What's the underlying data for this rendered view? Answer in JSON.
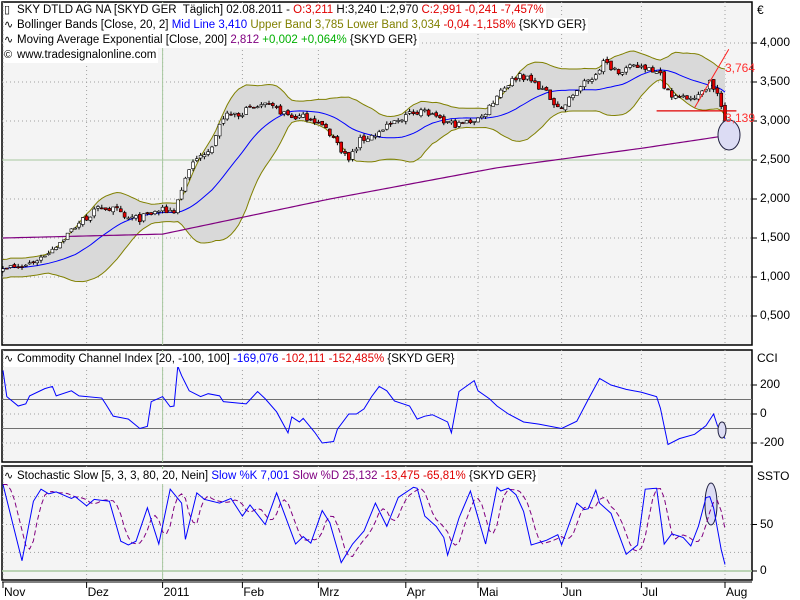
{
  "header": {
    "symbol": "SKY DTLD AG NA [SKYD GER  Täglich] 02.08.2011 -",
    "open": " O:3,211",
    "high_low": " H:3,240 L:2,970",
    "close_change": " C:2,991 -0,241 -7,457%"
  },
  "bollinger": {
    "name": "Bollinger Bands [Close, 20, 2]",
    "mid": " Mid Line 3,410",
    "bands": " Upper Band 3,785 Lower Band 3,034",
    "change": " -0,04 -1,158%",
    "symbol": " {SKYD GER}"
  },
  "ema": {
    "name": "Moving Average Exponential [Close, 200]",
    "value": " 2,812",
    "change": " +0,002 +0,064%",
    "symbol": " {SKYD GER}"
  },
  "copyright": "www.tradesignalonline.com",
  "cci_legend": {
    "name": "Commodity Channel Index [20, -100, 100]",
    "value": " -169,076",
    "change": " -102,111 -152,485%",
    "symbol": " {SKYD GER}"
  },
  "stoch_legend": {
    "name": "Stochastic Slow [5, 3, 3, 80, 20, Nein]",
    "k": " Slow %K 7,001",
    "d": " Slow %D 25,132",
    "change": " -13,475 -65,81%",
    "symbol": " {SKYD GER}"
  },
  "axes": {
    "price_unit": "€",
    "price_ticks": [
      "4,000",
      "3,500",
      "3,000",
      "2,500",
      "2,000",
      "1,500",
      "1,000",
      "0,500"
    ],
    "cci_label": "CCI",
    "cci_ticks": [
      "200",
      "0",
      "-200"
    ],
    "stoch_label": "SSTO",
    "stoch_ticks": [
      "50",
      "0"
    ],
    "months": [
      "Nov",
      "Dez",
      "2011",
      "Feb",
      "Mrz",
      "Apr",
      "Mai",
      "Jun",
      "Jul",
      "Aug"
    ]
  },
  "annotations": {
    "resistance_label": "3,764",
    "support_label": "3,139"
  },
  "colors": {
    "up": "#ffffff",
    "down": "#e00000",
    "mid": "#0000ff",
    "band": "#808000",
    "bandfill": "#d9d9d9",
    "ema": "#800080",
    "cci": "#0000ff",
    "k": "#0000ff",
    "d": "#800080",
    "grid": "#a0a0a0",
    "cross": "#a8c8a0"
  },
  "chart_data": [
    {
      "type": "candlestick",
      "title": "SKY DTLD AG NA [SKYD GER Täglich]",
      "xlabel": "",
      "ylabel": "€",
      "xlim": [
        0,
        197
      ],
      "ylim": [
        0.3,
        4.3
      ],
      "month_ticks": [
        0,
        22,
        42,
        63,
        83,
        106,
        125,
        147,
        168,
        190
      ],
      "close_keypoints": [
        [
          0,
          1.15
        ],
        [
          4,
          1.1
        ],
        [
          10,
          1.25
        ],
        [
          15,
          1.45
        ],
        [
          20,
          1.7
        ],
        [
          26,
          1.9
        ],
        [
          30,
          1.85
        ],
        [
          32,
          1.75
        ],
        [
          36,
          1.75
        ],
        [
          41,
          1.85
        ],
        [
          45,
          1.85
        ],
        [
          49,
          2.4
        ],
        [
          55,
          2.7
        ],
        [
          58,
          3.05
        ],
        [
          62,
          3.1
        ],
        [
          68,
          3.2
        ],
        [
          72,
          3.15
        ],
        [
          76,
          3.05
        ],
        [
          81,
          3.05
        ],
        [
          86,
          2.85
        ],
        [
          91,
          2.5
        ],
        [
          94,
          2.75
        ],
        [
          99,
          2.85
        ],
        [
          105,
          3.05
        ],
        [
          110,
          3.15
        ],
        [
          115,
          3.0
        ],
        [
          120,
          2.95
        ],
        [
          126,
          3.05
        ],
        [
          131,
          3.4
        ],
        [
          136,
          3.6
        ],
        [
          141,
          3.45
        ],
        [
          147,
          3.15
        ],
        [
          151,
          3.4
        ],
        [
          155,
          3.55
        ],
        [
          158,
          3.75
        ],
        [
          162,
          3.65
        ],
        [
          168,
          3.7
        ],
        [
          173,
          3.65
        ],
        [
          174,
          3.4
        ],
        [
          178,
          3.3
        ],
        [
          183,
          3.3
        ],
        [
          186,
          3.5
        ],
        [
          188,
          3.35
        ],
        [
          190,
          2.99
        ]
      ],
      "ema200_keypoints": [
        [
          0,
          1.5
        ],
        [
          42,
          1.55
        ],
        [
          86,
          2.0
        ],
        [
          130,
          2.4
        ],
        [
          168,
          2.65
        ],
        [
          190,
          2.81
        ]
      ],
      "crosshair": {
        "day": 42,
        "price": 2.5
      },
      "support_line": {
        "from_day": 172,
        "to_day": 193,
        "price": 3.13
      },
      "trend_line": {
        "from": [
          182,
          3.17
        ],
        "to": [
          191,
          3.92
        ]
      }
    },
    {
      "type": "line",
      "title": "Commodity Channel Index",
      "ylim": [
        -300,
        350
      ],
      "levels": [
        100,
        -100
      ],
      "series": [
        {
          "name": "CCI",
          "points": [
            [
              0,
              300
            ],
            [
              1,
              120
            ],
            [
              4,
              55
            ],
            [
              6,
              70
            ],
            [
              7,
              125
            ],
            [
              11,
              175
            ],
            [
              13,
              190
            ],
            [
              14,
              125
            ],
            [
              18,
              160
            ],
            [
              20,
              125
            ],
            [
              26,
              110
            ],
            [
              27,
              70
            ],
            [
              29,
              -15
            ],
            [
              33,
              -35
            ],
            [
              36,
              -100
            ],
            [
              38,
              -85
            ],
            [
              39,
              85
            ],
            [
              42,
              120
            ],
            [
              44,
              50
            ],
            [
              45,
              55
            ],
            [
              46,
              330
            ],
            [
              47,
              265
            ],
            [
              49,
              160
            ],
            [
              52,
              120
            ],
            [
              54,
              140
            ],
            [
              57,
              125
            ],
            [
              58,
              85
            ],
            [
              64,
              70
            ],
            [
              67,
              155
            ],
            [
              69,
              105
            ],
            [
              72,
              15
            ],
            [
              75,
              -130
            ],
            [
              76,
              -20
            ],
            [
              78,
              -55
            ],
            [
              79,
              -30
            ],
            [
              82,
              -125
            ],
            [
              84,
              -200
            ],
            [
              87,
              -190
            ],
            [
              88,
              -105
            ],
            [
              91,
              0
            ],
            [
              93,
              0
            ],
            [
              95,
              35
            ],
            [
              97,
              120
            ],
            [
              99,
              190
            ],
            [
              101,
              160
            ],
            [
              103,
              90
            ],
            [
              107,
              55
            ],
            [
              109,
              -35
            ],
            [
              111,
              -15
            ],
            [
              113,
              -5
            ],
            [
              117,
              -55
            ],
            [
              118,
              -130
            ],
            [
              120,
              155
            ],
            [
              124,
              230
            ],
            [
              125,
              160
            ],
            [
              128,
              105
            ],
            [
              130,
              55
            ],
            [
              133,
              0
            ],
            [
              137,
              -55
            ],
            [
              141,
              -70
            ],
            [
              147,
              -100
            ],
            [
              151,
              -50
            ],
            [
              154,
              100
            ],
            [
              157,
              245
            ],
            [
              160,
              200
            ],
            [
              164,
              170
            ],
            [
              168,
              150
            ],
            [
              172,
              120
            ],
            [
              173,
              40
            ],
            [
              175,
              -210
            ],
            [
              178,
              -170
            ],
            [
              182,
              -140
            ],
            [
              185,
              -80
            ],
            [
              187,
              0
            ],
            [
              188,
              -80
            ],
            [
              190,
              -169
            ]
          ]
        }
      ]
    },
    {
      "type": "line",
      "title": "Stochastic Slow",
      "ylim": [
        0,
        100
      ],
      "levels": [
        80,
        50,
        20
      ],
      "series": [
        {
          "name": "Slow %K",
          "points": [
            [
              0,
              93
            ],
            [
              5,
              11
            ],
            [
              8,
              75
            ],
            [
              10,
              88
            ],
            [
              12,
              83
            ],
            [
              14,
              85
            ],
            [
              18,
              78
            ],
            [
              19,
              80
            ],
            [
              22,
              70
            ],
            [
              24,
              77
            ],
            [
              28,
              75
            ],
            [
              31,
              32
            ],
            [
              33,
              28
            ],
            [
              35,
              32
            ],
            [
              38,
              68
            ],
            [
              41,
              29
            ],
            [
              44,
              88
            ],
            [
              47,
              73
            ],
            [
              48,
              34
            ],
            [
              51,
              84
            ],
            [
              53,
              77
            ],
            [
              57,
              73
            ],
            [
              60,
              78
            ],
            [
              63,
              59
            ],
            [
              65,
              71
            ],
            [
              69,
              50
            ],
            [
              72,
              84
            ],
            [
              73,
              73
            ],
            [
              77,
              29
            ],
            [
              79,
              37
            ],
            [
              81,
              30
            ],
            [
              84,
              65
            ],
            [
              86,
              52
            ],
            [
              89,
              9
            ],
            [
              92,
              29
            ],
            [
              95,
              43
            ],
            [
              98,
              73
            ],
            [
              101,
              48
            ],
            [
              104,
              79
            ],
            [
              108,
              90
            ],
            [
              109,
              89
            ],
            [
              111,
              59
            ],
            [
              114,
              48
            ],
            [
              116,
              36
            ],
            [
              117,
              17
            ],
            [
              120,
              57
            ],
            [
              123,
              86
            ],
            [
              127,
              29
            ],
            [
              130,
              90
            ],
            [
              131,
              86
            ],
            [
              133,
              89
            ],
            [
              135,
              82
            ],
            [
              137,
              64
            ],
            [
              139,
              28
            ],
            [
              143,
              33
            ],
            [
              146,
              39
            ],
            [
              147,
              28
            ],
            [
              151,
              73
            ],
            [
              153,
              66
            ],
            [
              154,
              67
            ],
            [
              156,
              87
            ],
            [
              157,
              73
            ],
            [
              160,
              62
            ],
            [
              164,
              18
            ],
            [
              167,
              28
            ],
            [
              169,
              88
            ],
            [
              172,
              89
            ],
            [
              174,
              29
            ],
            [
              176,
              40
            ],
            [
              179,
              36
            ],
            [
              181,
              27
            ],
            [
              183,
              48
            ],
            [
              185,
              79
            ],
            [
              186,
              80
            ],
            [
              187,
              68
            ],
            [
              189,
              23
            ],
            [
              190,
              7
            ]
          ]
        },
        {
          "name": "Slow %D",
          "derived": "3-period average of %K"
        }
      ]
    }
  ]
}
